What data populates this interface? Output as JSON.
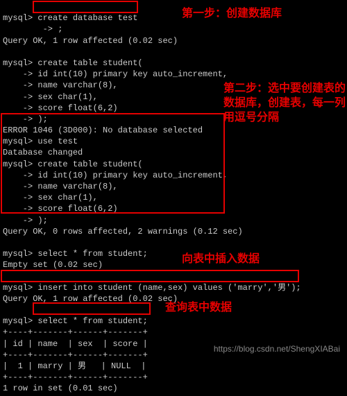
{
  "lines": {
    "l1": "mysql> create database test",
    "l2": "        -> ;",
    "l3": "Query OK, 1 row affected (0.02 sec)",
    "l4": "",
    "l5": "mysql> create table student(",
    "l6": "    -> id int(10) primary key auto_increment,",
    "l7": "    -> name varchar(8),",
    "l8": "    -> sex char(1),",
    "l9": "    -> score float(6,2)",
    "l10": "    -> );",
    "l11": "ERROR 1046 (3D000): No database selected",
    "l12": "mysql> use test",
    "l13": "Database changed",
    "l14": "mysql> create table student(",
    "l15": "    -> id int(10) primary key auto_increment,",
    "l16": "    -> name varchar(8),",
    "l17": "    -> sex char(1),",
    "l18": "    -> score float(6,2)",
    "l19": "    -> );",
    "l20": "Query OK, 0 rows affected, 2 warnings (0.12 sec)",
    "l21": "",
    "l22": "mysql> select * from student;",
    "l23": "Empty set (0.02 sec)",
    "l24": "",
    "l25": "mysql> insert into student (name,sex) values ('marry','男');",
    "l26": "Query OK, 1 row affected (0.02 sec)",
    "l27": "",
    "l28": "mysql> select * from student;",
    "l29": "+----+-------+------+-------+",
    "l30": "| id | name  | sex  | score |",
    "l31": "+----+-------+------+-------+",
    "l32": "|  1 | marry | 男   | NULL  |",
    "l33": "+----+-------+------+-------+",
    "l34": "1 row in set (0.01 sec)"
  },
  "annotations": {
    "a1": "第一步：创建数据库",
    "a2": "第二步：选中要创建表的\n数据库，创建表，每一列\n用逗号分隔",
    "a3": "向表中插入数据",
    "a4": "查询表中数据"
  },
  "watermark": "https://blog.csdn.net/ShengXIABai"
}
